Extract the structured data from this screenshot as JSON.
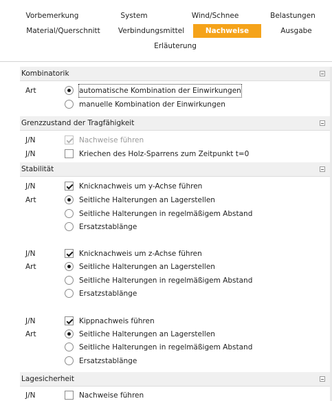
{
  "tabs": {
    "vorbemerkung": "Vorbemerkung",
    "system": "System",
    "wind_schnee": "Wind/Schnee",
    "belastungen": "Belastungen",
    "material": "Material/Querschnitt",
    "verbindungsmittel": "Verbindungsmittel",
    "nachweise": "Nachweise",
    "ausgabe": "Ausgabe",
    "erlaeuterung": "Erläuterung"
  },
  "accent_color": "#f5a31a",
  "labels": {
    "art": "Art",
    "jn": "J/N"
  },
  "kombinatorik": {
    "title": "Kombinatorik",
    "opt_auto": "automatische Kombination der Einwirkungen",
    "opt_manual": "manuelle Kombination der Einwirkungen",
    "selected": "automatische Kombination der Einwirkungen"
  },
  "grenzzustand": {
    "title": "Grenzzustand der Tragfähigkeit",
    "nachweise": {
      "label": "Nachweise führen",
      "checked": true,
      "enabled": false
    },
    "kriechen": {
      "label": "Kriechen des Holz-Sparrens zum Zeitpunkt t=0",
      "checked": false
    }
  },
  "stabilitaet": {
    "title": "Stabilität",
    "opt_lager": "Seitliche Halterungen an Lagerstellen",
    "opt_regel": "Seitliche Halterungen in regelmäßigem Abstand",
    "opt_ersatz": "Ersatzstablänge",
    "knick_y": {
      "label": "Knicknachweis um y-Achse führen",
      "checked": true,
      "selected": "Seitliche Halterungen an Lagerstellen"
    },
    "knick_z": {
      "label": "Knicknachweis um z-Achse führen",
      "checked": true,
      "selected": "Seitliche Halterungen an Lagerstellen"
    },
    "kipp": {
      "label": "Kippnachweis führen",
      "checked": true,
      "selected": "Seitliche Halterungen an Lagerstellen"
    }
  },
  "lagesicherheit": {
    "title": "Lagesicherheit",
    "nachweise": {
      "label": "Nachweise führen",
      "checked": false
    }
  }
}
